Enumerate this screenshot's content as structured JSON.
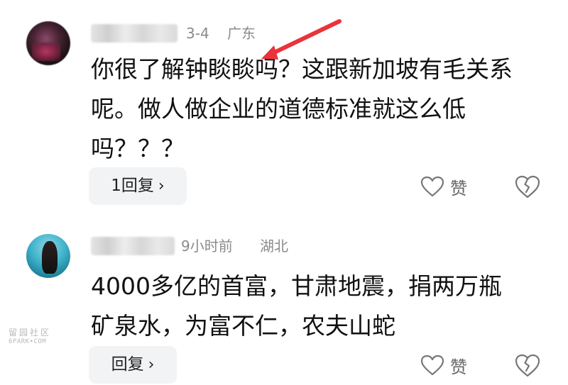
{
  "comments": [
    {
      "date": "3-4",
      "location": "广东",
      "body_lines": [
        "你很了解钟睒睒吗？这跟新加坡有毛关系",
        "呢。做人做企业的道德标准就这么低",
        "吗？？？"
      ],
      "reply_label": "1回复",
      "reply_chevron": "›",
      "like_label": "赞"
    },
    {
      "date": "9小时前",
      "location": "湖北",
      "body_lines": [
        "4000多亿的首富，甘肃地震，捐两万瓶",
        "矿泉水，为富不仁，农夫山蛇"
      ],
      "reply_label": "回复",
      "reply_chevron": "›",
      "like_label": "赞"
    }
  ],
  "watermark": {
    "top": "留园社区",
    "bottom": "6PARK•COM"
  },
  "colors": {
    "annotation_arrow": "#e8343a",
    "meta_text": "#8a8a8a",
    "reply_bg": "#f2f3f5"
  },
  "icons": {
    "like": "heart-outline-icon",
    "dislike": "broken-heart-icon",
    "annotation": "red-arrow"
  }
}
